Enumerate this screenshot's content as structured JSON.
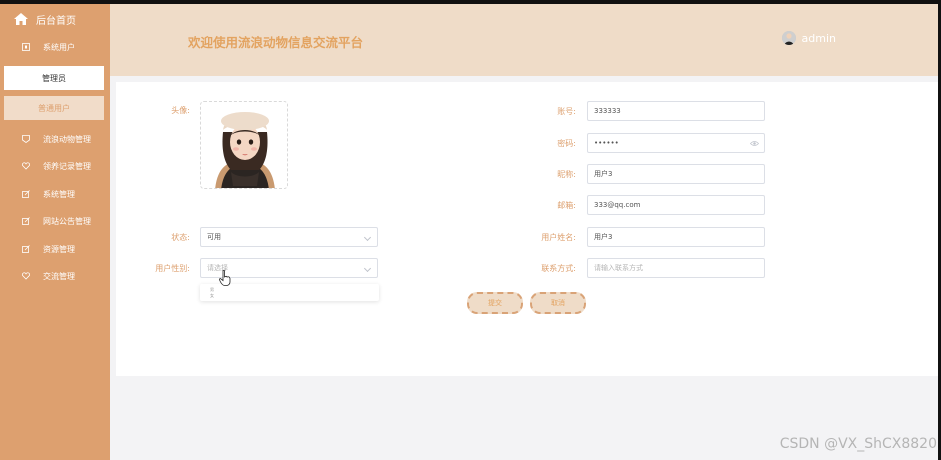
{
  "sidebar": {
    "home_label": "后台首页",
    "items": [
      {
        "label": "系统用户",
        "icon": "user-icon"
      },
      {
        "label": "流浪动物管理",
        "icon": "shield-icon"
      },
      {
        "label": "领养记录管理",
        "icon": "heart-icon"
      },
      {
        "label": "系统管理",
        "icon": "edit-icon"
      },
      {
        "label": "网站公告管理",
        "icon": "edit-icon"
      },
      {
        "label": "资源管理",
        "icon": "edit-icon"
      },
      {
        "label": "交流管理",
        "icon": "heart-icon"
      }
    ],
    "subitems": [
      "管理员",
      "普通用户"
    ]
  },
  "header": {
    "title": "欢迎使用流浪动物信息交流平台",
    "username": "admin"
  },
  "form": {
    "avatar_label": "头像:",
    "status_label": "状态:",
    "status_value": "可用",
    "gender_label": "用户性别:",
    "gender_placeholder": "请选择",
    "gender_options": [
      "男",
      "女"
    ],
    "account_label": "账号:",
    "account_value": "333333",
    "password_label": "密码:",
    "password_value": "••••••",
    "nickname_label": "昵称:",
    "nickname_value": "用户3",
    "email_label": "邮箱:",
    "email_value": "333@qq.com",
    "realname_label": "用户姓名:",
    "realname_value": "用户3",
    "contact_label": "联系方式:",
    "contact_placeholder": "请输入联系方式",
    "submit_label": "提交",
    "cancel_label": "取消"
  },
  "watermark": "CSDN @VX_ShCX8820",
  "colors": {
    "sidebar": "#dda06f",
    "header": "#efdcc8",
    "accent": "#e3a360"
  }
}
